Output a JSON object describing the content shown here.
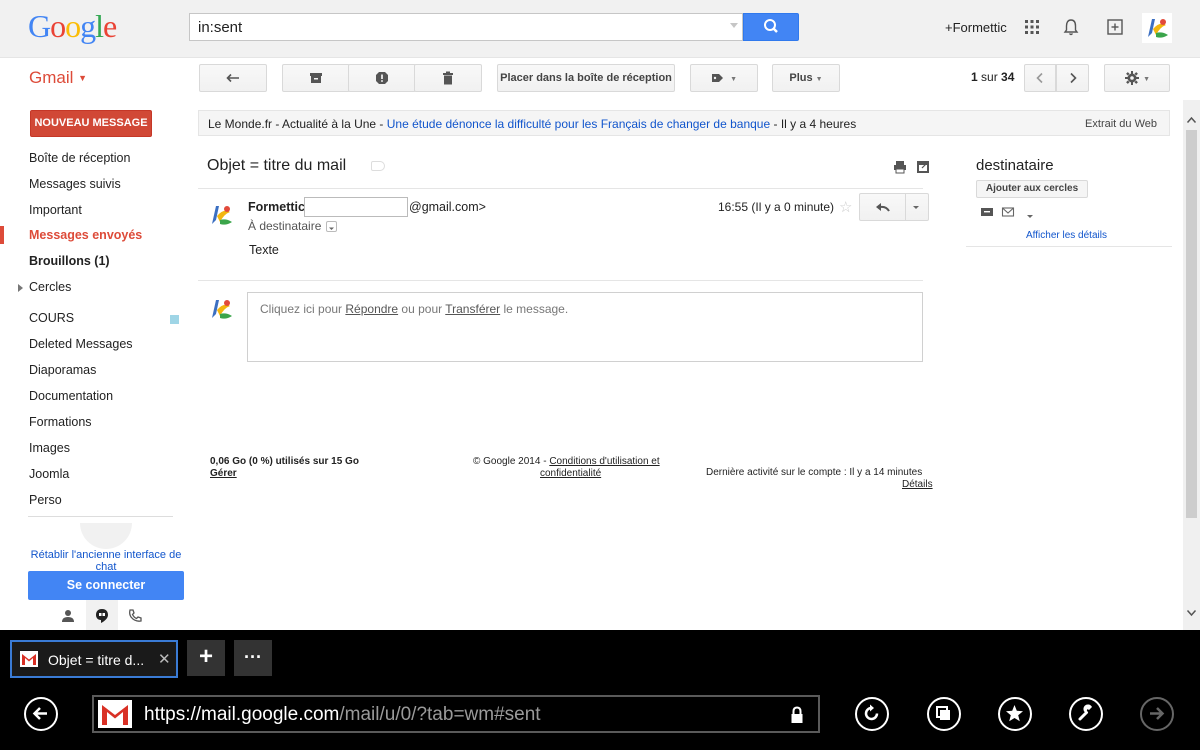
{
  "header": {
    "logo_text": "Google",
    "search_value": "in:sent",
    "user_link": "+Formettic",
    "icons": [
      "apps-grid-icon",
      "bell-icon",
      "share-plus-icon",
      "avatar-icon"
    ]
  },
  "gmail_menu": {
    "label": "Gmail"
  },
  "toolbar": {
    "move_to_inbox_label": "Placer dans la boîte de réception",
    "more_label": "Plus",
    "pager": {
      "current": "1",
      "separator": "sur",
      "total": "34"
    }
  },
  "sidebar": {
    "compose_label": "NOUVEAU MESSAGE",
    "items": [
      {
        "label": "Boîte de réception"
      },
      {
        "label": "Messages suivis"
      },
      {
        "label": "Important"
      },
      {
        "label": "Messages envoyés"
      },
      {
        "label": "Brouillons (1)"
      },
      {
        "label": "Cercles"
      },
      {
        "label": "COURS"
      },
      {
        "label": "Deleted Messages"
      },
      {
        "label": "Diaporamas"
      },
      {
        "label": "Documentation"
      },
      {
        "label": "Formations"
      },
      {
        "label": "Images"
      },
      {
        "label": "Joomla"
      },
      {
        "label": "Perso"
      }
    ],
    "active_item": "Messages envoyés",
    "restore_chat_label": "Rétablir l'ancienne interface de chat",
    "connect_label": "Se connecter"
  },
  "newsbar": {
    "source": "Le Monde.fr - Actualité à la Une - ",
    "headline": "Une étude dénonce la difficulté pour les Français de changer de banque",
    "age": " - Il y a 4 heures",
    "extract_label": "Extrait du Web"
  },
  "message": {
    "subject": "Objet = titre du mail",
    "sender_name": "Formettic",
    "sender_email_suffix": "@gmail.com>",
    "to_line": "À destinataire",
    "time": "16:55 (Il y a 0 minute)",
    "body": "Texte",
    "reply_prompt": {
      "prefix": "Cliquez ici pour ",
      "reply_link": "Répondre",
      "middle": " ou pour ",
      "forward_link": "Transférer",
      "suffix": " le message."
    }
  },
  "footer": {
    "storage": "0,06 Go (0 %) utilisés sur 15 Go",
    "manage": "Gérer",
    "copyright": "© Google 2014 - ",
    "terms_link_1": "Conditions d'utilisation et",
    "terms_link_2": "confidentialité",
    "last_activity": "Dernière activité sur le compte : Il y a 14 minutes",
    "details": "Détails"
  },
  "right_panel": {
    "contact_name": "destinataire",
    "add_to_circles": "Ajouter aux cercles",
    "show_details": "Afficher les détails"
  },
  "browser": {
    "tab_title": "Objet = titre d...",
    "tab_close": "✕",
    "new_tab": "+",
    "more_tabs": "···",
    "url_host": "https://mail.google.com",
    "url_path": "/mail/u/0/?tab=wm#sent"
  },
  "colors": {
    "gmail_red": "#dd4b39",
    "compose_red": "#d14836",
    "blue": "#4285f4",
    "link_blue": "#1155cc"
  }
}
